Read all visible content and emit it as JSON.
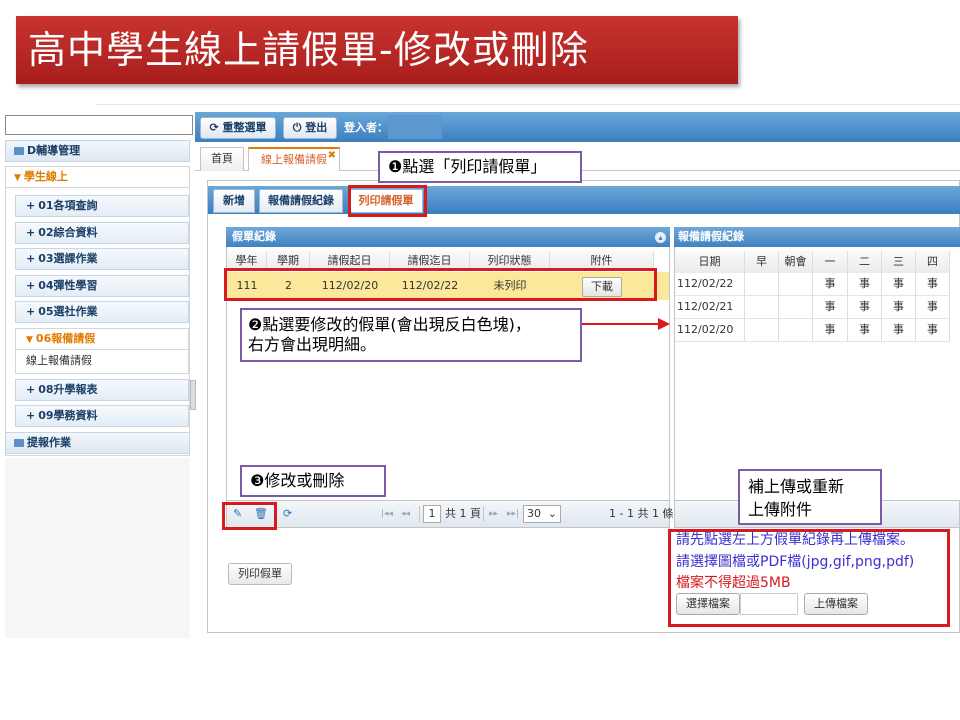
{
  "slide_title": "高中學生線上請假單-修改或刪除",
  "nav": {
    "groups": [
      {
        "label": "D輔導管理"
      },
      {
        "label": "學生線上"
      },
      {
        "label": "提報作業"
      }
    ],
    "items": [
      {
        "label": "01各項查詢"
      },
      {
        "label": "02綜合資料"
      },
      {
        "label": "03選課作業"
      },
      {
        "label": "04彈性學習"
      },
      {
        "label": "05選社作業"
      },
      {
        "label": "06報備請假"
      },
      {
        "label": "08升學報表"
      },
      {
        "label": "09學務資料"
      }
    ],
    "leaf": "線上報備請假"
  },
  "toolbar": {
    "reset_label": "重整選單",
    "logout_label": "登出",
    "login_label": "登入者："
  },
  "tabs": {
    "home": "首頁",
    "current": "線上報備請假"
  },
  "subtabs": [
    "新增",
    "報備請假紀錄",
    "列印請假單"
  ],
  "records": {
    "title": "假單紀錄",
    "headers": [
      "學年",
      "學期",
      "請假起日",
      "請假迄日",
      "列印狀態",
      "附件"
    ],
    "row": {
      "year": "111",
      "term": "2",
      "start": "112/02/20",
      "end": "112/02/22",
      "status": "未列印",
      "download": "下載"
    }
  },
  "pager": {
    "page": "1",
    "total_pages": "共 1 頁",
    "page_size": "30",
    "summary": "1 - 1 共 1 條"
  },
  "print_button": "列印假單",
  "detail": {
    "title": "報備請假紀錄",
    "headers": [
      "日期",
      "早",
      "朝會",
      "一",
      "二",
      "三",
      "四"
    ],
    "rows": [
      {
        "date": "112/02/22",
        "marks": [
          "事",
          "事",
          "事",
          "事"
        ]
      },
      {
        "date": "112/02/21",
        "marks": [
          "事",
          "事",
          "事",
          "事"
        ]
      },
      {
        "date": "112/02/20",
        "marks": [
          "事",
          "事",
          "事",
          "事"
        ]
      }
    ]
  },
  "upload": {
    "line1": "請先點選左上方假單紀錄再上傳檔案。",
    "line2": "請選擇圖檔或PDF檔(jpg,gif,png,pdf)",
    "line3": "檔案不得超過5MB",
    "choose_label": "選擇檔案",
    "upload_label": "上傳檔案"
  },
  "callouts": {
    "step1": "❶點選「列印請假單」",
    "step2_line1": "❷點選要修改的假單(會出現反白色塊)，",
    "step2_line2": "右方會出現明細。",
    "step3": "❸修改或刪除",
    "reupload_line1": "補上傳或重新",
    "reupload_line2": "上傳附件"
  },
  "colors": {
    "title_bg": "#b5272a",
    "header_blue": "#3b7fc0",
    "active_orange": "#e07b00",
    "selected_row": "#fbe89a",
    "annotation_red": "#d71920",
    "callout_border": "#7b5aa6",
    "instruction_blue": "#3a2fd0"
  }
}
